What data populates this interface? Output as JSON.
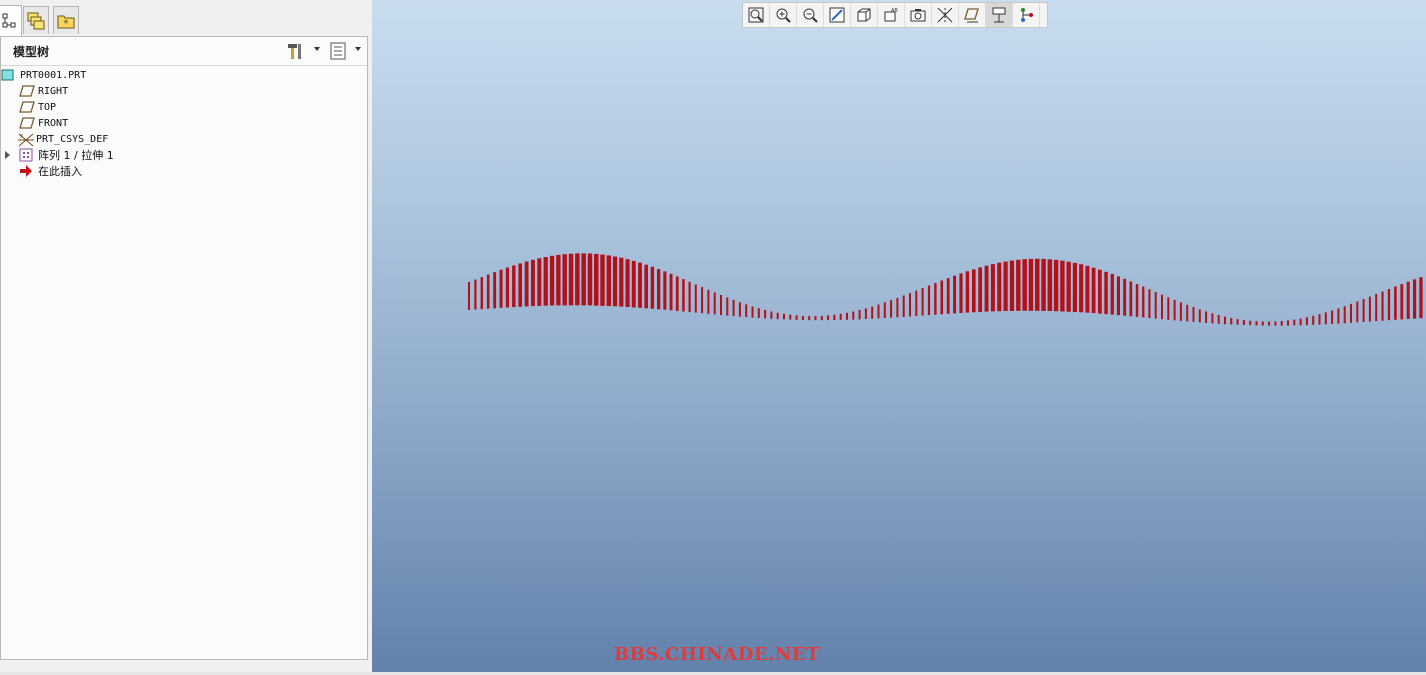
{
  "model_tree": {
    "title": "模型树",
    "tabs": [
      {
        "icon": "model-tree-icon"
      },
      {
        "icon": "layers-icon"
      },
      {
        "icon": "favorites-folder-icon"
      }
    ],
    "items": [
      {
        "label": "PRT0001.PRT",
        "icon": "part-icon"
      },
      {
        "label": "RIGHT",
        "icon": "datum-plane-icon"
      },
      {
        "label": "TOP",
        "icon": "datum-plane-icon"
      },
      {
        "label": "FRONT",
        "icon": "datum-plane-icon"
      },
      {
        "label": "PRT_CSYS_DEF",
        "icon": "coordinate-system-icon"
      },
      {
        "label": "阵列 1 / 拉伸 1",
        "icon": "pattern-icon",
        "expandable": true
      },
      {
        "label": "在此插入",
        "icon": "insert-here-arrow-icon"
      }
    ]
  },
  "toolbar": {
    "buttons": [
      {
        "icon": "refit-icon"
      },
      {
        "icon": "zoom-in-icon"
      },
      {
        "icon": "zoom-out-icon"
      },
      {
        "icon": "repaint-icon"
      },
      {
        "icon": "display-style-icon"
      },
      {
        "icon": "saved-views-icon"
      },
      {
        "icon": "view-manager-icon"
      },
      {
        "icon": "datum-planes-icon"
      },
      {
        "icon": "datum-axes-icon"
      },
      {
        "icon": "datum-points-icon",
        "active": true
      },
      {
        "icon": "coordinate-systems-icon"
      }
    ]
  },
  "viewport": {
    "watermark": "BBS.CHINADE.NET",
    "feature_color": "#b3101a"
  },
  "colors": {
    "viewport_top": "#c9ddef",
    "viewport_bottom": "#6282ac",
    "watermark": "#e23a3a"
  }
}
